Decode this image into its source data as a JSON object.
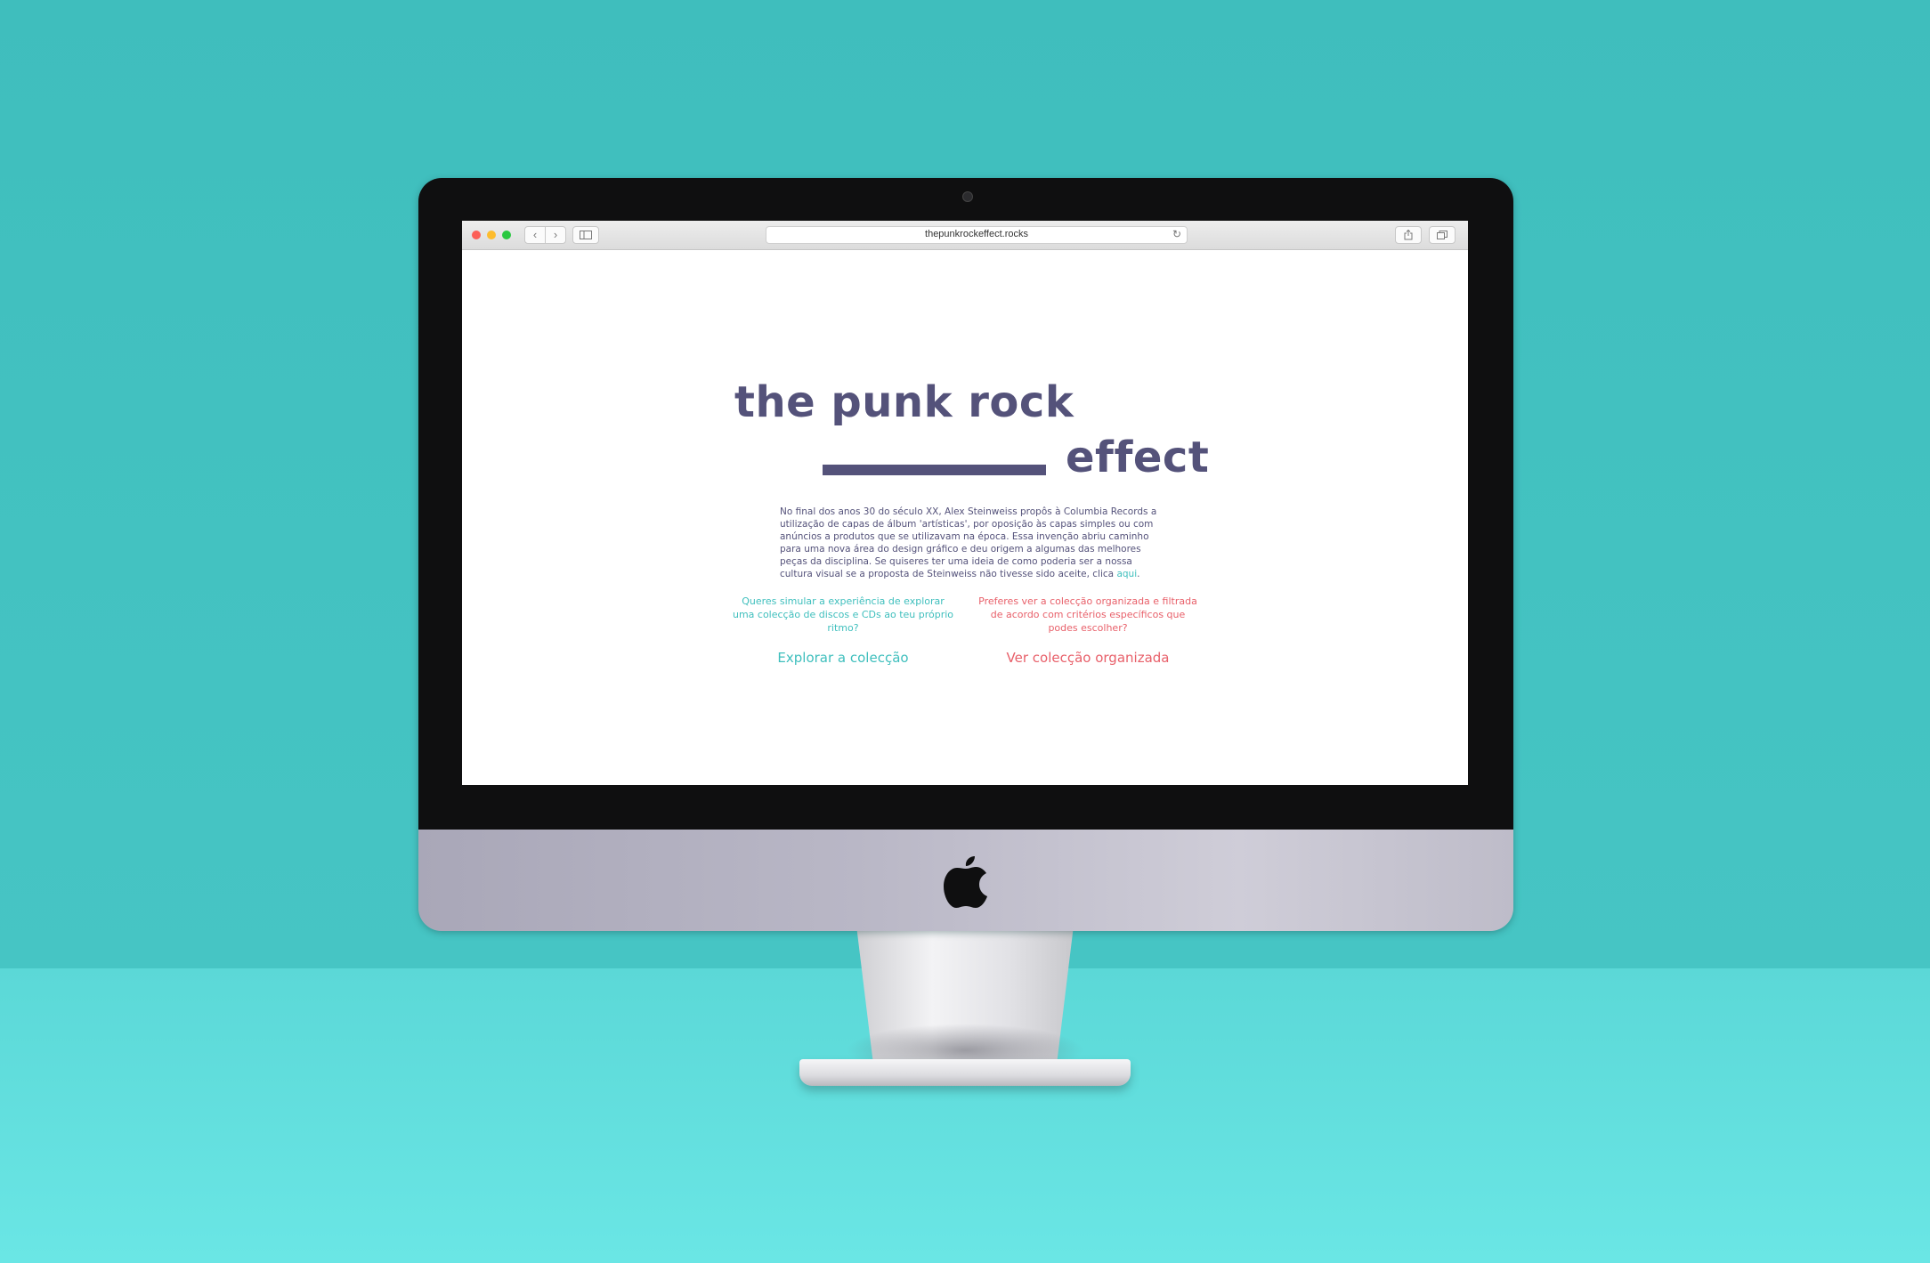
{
  "browser": {
    "url": "thepunkrockeffect.rocks",
    "back_icon": "‹",
    "forward_icon": "›",
    "reload_icon": "↻"
  },
  "page": {
    "title_line1": "the punk rock",
    "title_line2": "effect",
    "intro_text": "No final dos anos 30 do século XX, Alex Steinweiss propôs à Columbia Records a utilização de capas de álbum 'artísticas', por oposição às capas simples ou com anúncios a produtos que se utilizavam na época. Essa invenção abriu caminho para uma nova área do design gráfico e deu origem a algumas das melhores peças da disciplina. Se quiseres ter uma ideia de como poderia ser a nossa cultura visual se a proposta de Steinweiss não tivesse sido aceite, clica ",
    "intro_link": "aqui",
    "intro_end": ".",
    "left_question": "Queres simular a experiência de explorar uma colecção de discos e CDs ao teu próprio ritmo?",
    "left_cta": "Explorar a colecção",
    "right_question": "Preferes ver a colecção organizada e filtrada de acordo com critérios específicos que podes escolher?",
    "right_cta": "Ver colecção organizada"
  },
  "colors": {
    "brand_purple": "#54527a",
    "accent_teal": "#3fbfbd",
    "accent_coral": "#e8606a",
    "background_teal": "#46c5c4"
  }
}
